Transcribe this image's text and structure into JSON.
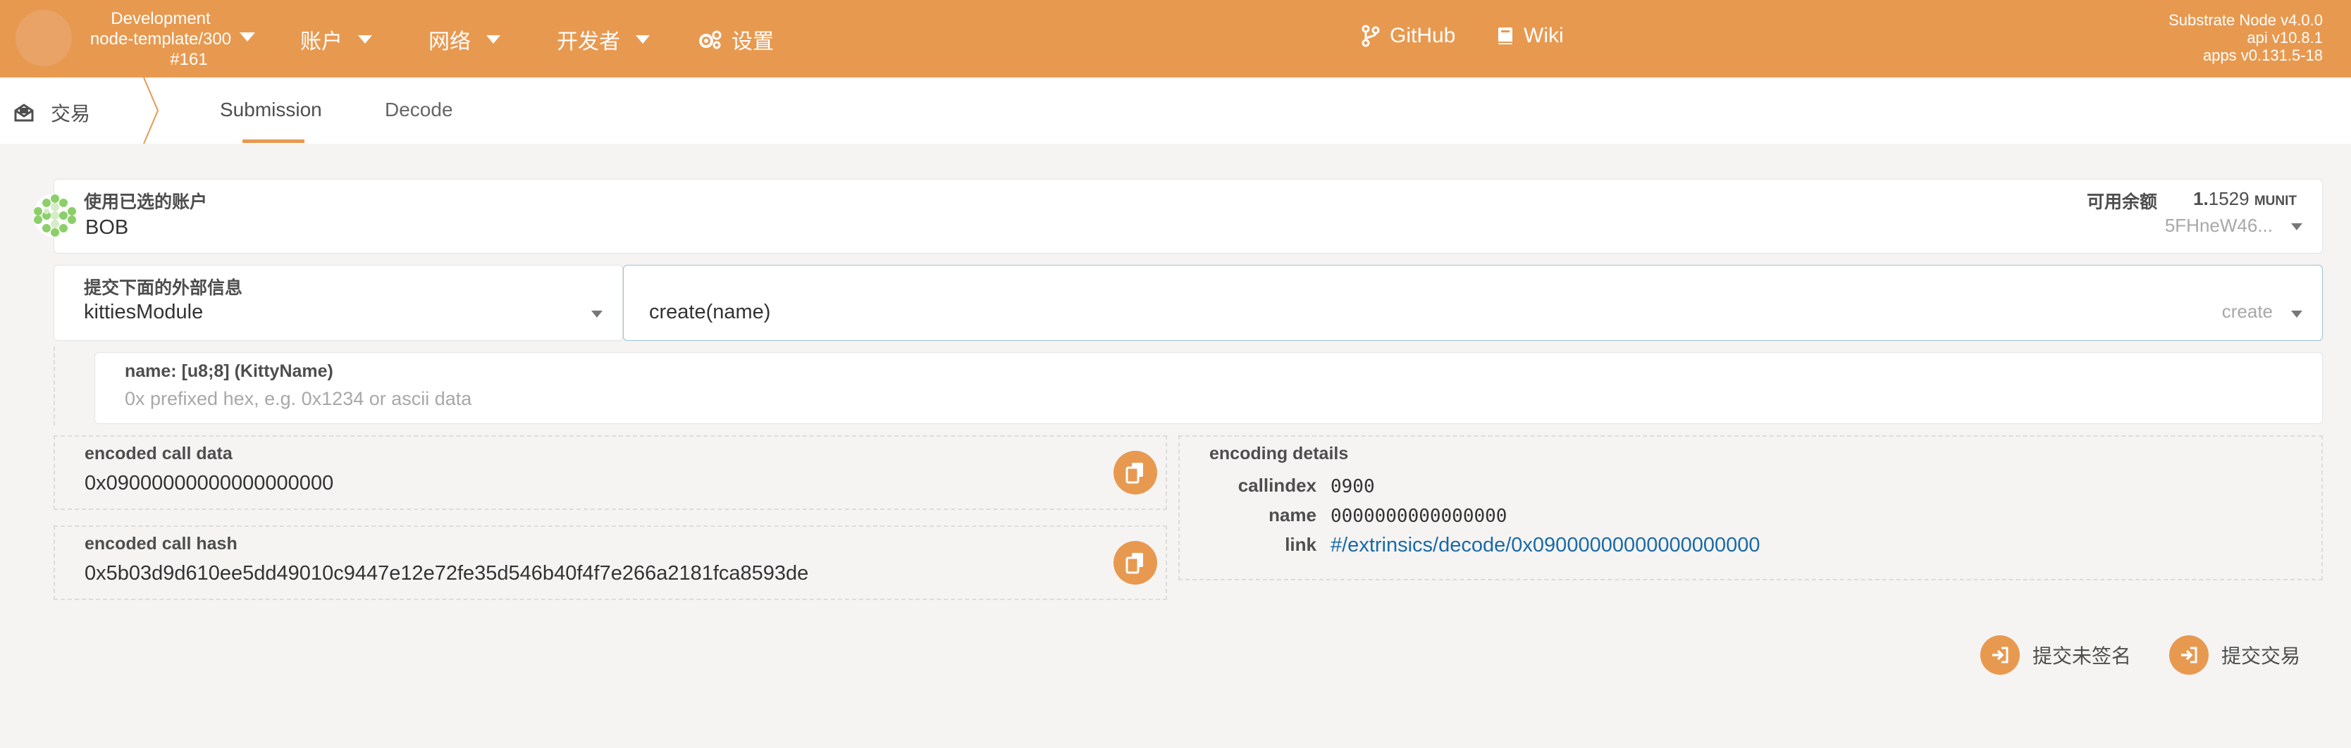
{
  "header": {
    "chain": {
      "name": "Development",
      "runtime": "node-template/300",
      "block": "#161"
    },
    "menu": [
      {
        "label": "账户",
        "icon": "none"
      },
      {
        "label": "网络",
        "icon": "none"
      },
      {
        "label": "开发者",
        "icon": "none"
      },
      {
        "label": "设置",
        "icon": "gears-icon"
      }
    ],
    "links": [
      {
        "label": "GitHub",
        "icon": "git-branch-icon"
      },
      {
        "label": "Wiki",
        "icon": "book-icon"
      }
    ],
    "version": {
      "node": "Substrate Node v4.0.0",
      "api": "api v10.8.1",
      "apps": "apps v0.131.5-18"
    },
    "background_color": "#e89950"
  },
  "tabbar": {
    "section_label": "交易",
    "tabs": [
      {
        "label": "Submission",
        "active": true
      },
      {
        "label": "Decode",
        "active": false
      }
    ]
  },
  "account": {
    "label": "使用已选的账户",
    "name": "BOB",
    "balance_label": "可用余额",
    "balance_int": "1.",
    "balance_dec": "1529",
    "balance_unit": "MUNIT",
    "address": "5FHneW46..."
  },
  "extrinsic": {
    "label": "提交下面的外部信息",
    "module": "kittiesModule",
    "call": "create(name)",
    "method": "create"
  },
  "param": {
    "label": "name: [u8;8] (KittyName)",
    "placeholder": "0x prefixed hex, e.g. 0x1234 or ascii data"
  },
  "call_data": {
    "label": "encoded call data",
    "value": "0x09000000000000000000"
  },
  "call_hash": {
    "label": "encoded call hash",
    "value": "0x5b03d9d610ee5dd49010c9447e12e72fe35d546b40f4f7e266a2181fca8593de"
  },
  "details": {
    "title": "encoding details",
    "callindex_label": "callindex",
    "callindex_value": "0900",
    "name_label": "name",
    "name_value": "0000000000000000",
    "link_label": "link",
    "link_value": "#/extrinsics/decode/0x09000000000000000000"
  },
  "actions": {
    "unsigned": "提交未签名",
    "signed": "提交交易"
  },
  "accent_color": "#e89950",
  "link_color": "#1a6aa6"
}
